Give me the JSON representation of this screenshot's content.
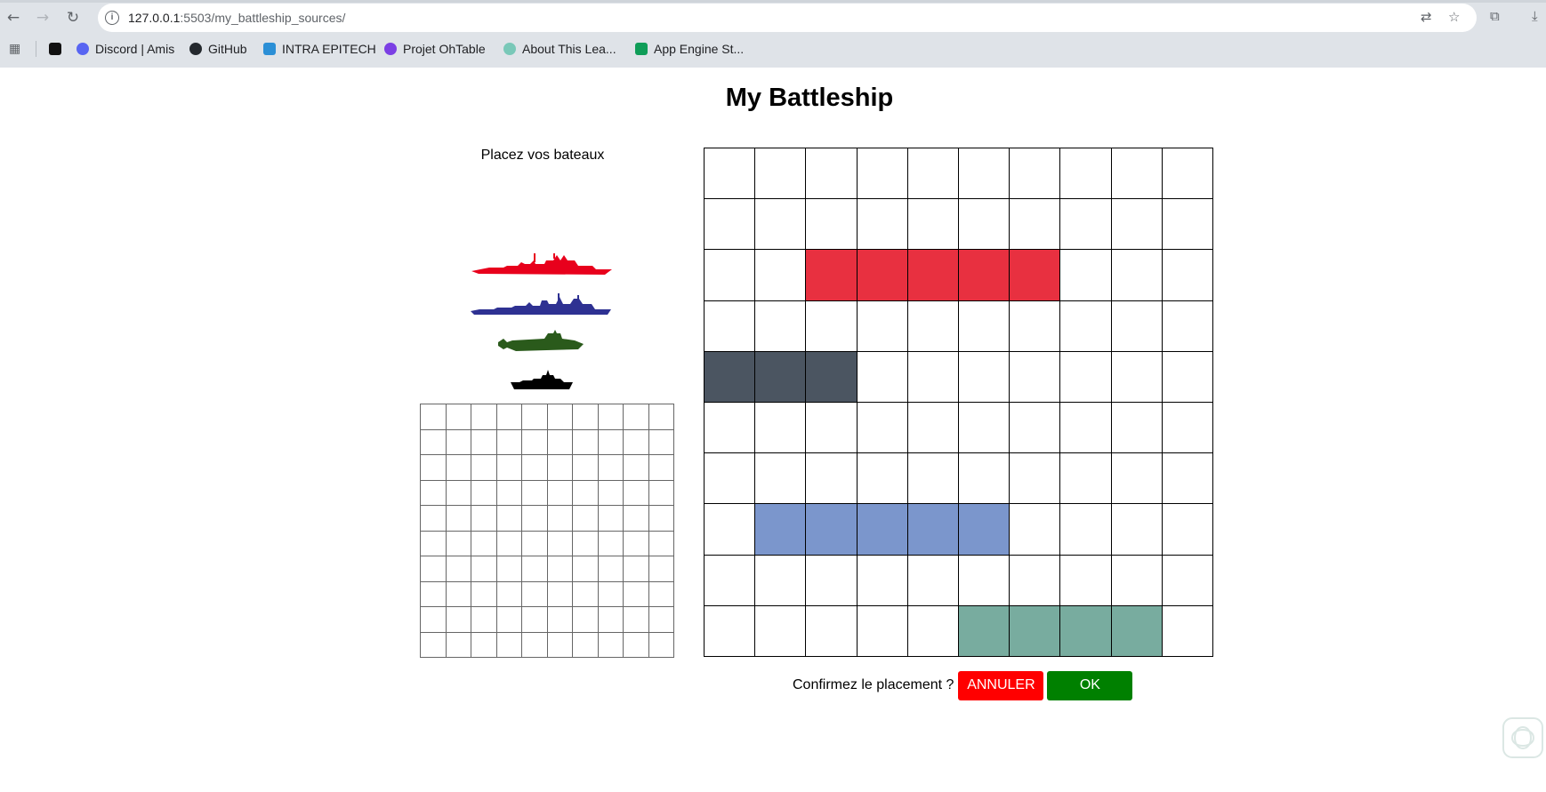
{
  "browser": {
    "url_host": "127.0.0.1",
    "url_rest": ":5503/my_battleship_sources/",
    "bookmarks": [
      {
        "label": "",
        "color": "#111111"
      },
      {
        "label": "Discord | Amis",
        "color": "#5865f2"
      },
      {
        "label": "GitHub",
        "color": "#24292e"
      },
      {
        "label": "INTRA EPITECH",
        "color": "#2b8fd6"
      },
      {
        "label": "Projet OhTable",
        "color": "#7b3fe4"
      },
      {
        "label": "About This Lea...",
        "color": "#79c8b8"
      },
      {
        "label": "App Engine St...",
        "color": "#0f9d58"
      }
    ]
  },
  "page": {
    "title": "My Battleship",
    "place_label": "Placez vos bateaux",
    "confirm_label": "Confirmez le placement ?",
    "cancel_label": "ANNULER",
    "ok_label": "OK"
  },
  "ships_palette": [
    {
      "name": "battleship",
      "color": "#e8001c"
    },
    {
      "name": "destroyer",
      "color": "#2e3192"
    },
    {
      "name": "submarine",
      "color": "#2a5a1b"
    },
    {
      "name": "patrol-boat",
      "color": "#000000"
    }
  ],
  "placed_ships": [
    {
      "name": "red-ship",
      "color": "#e83040",
      "row": 2,
      "col": 2,
      "length": 5,
      "orientation": "horizontal"
    },
    {
      "name": "gray-ship",
      "color": "#4b5561",
      "row": 4,
      "col": 0,
      "length": 3,
      "orientation": "horizontal"
    },
    {
      "name": "blue-ship",
      "color": "#7b96cc",
      "row": 7,
      "col": 1,
      "length": 5,
      "orientation": "horizontal"
    },
    {
      "name": "teal-ship",
      "color": "#78ac9f",
      "row": 9,
      "col": 5,
      "length": 4,
      "orientation": "horizontal"
    }
  ],
  "grid_size": 10
}
